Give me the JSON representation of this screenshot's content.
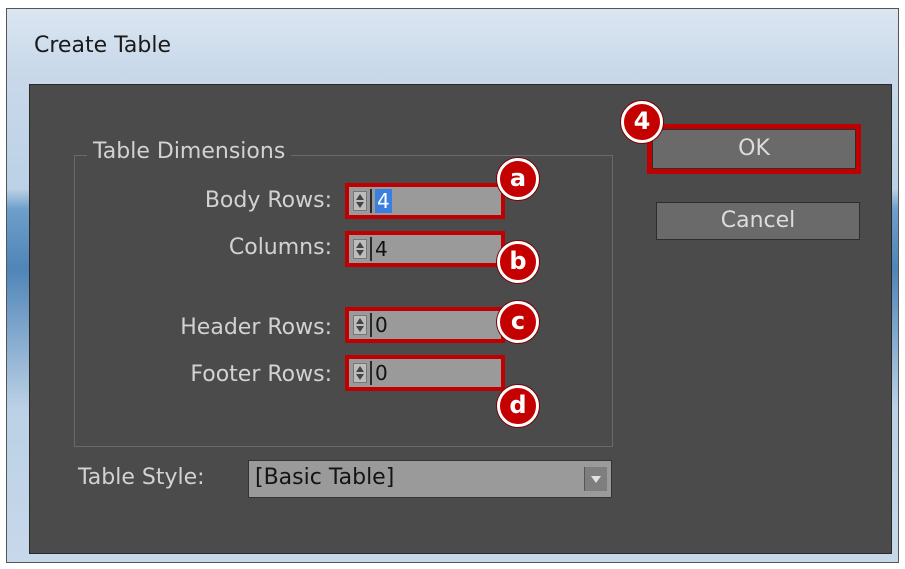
{
  "window": {
    "title": "Create Table"
  },
  "dimensions": {
    "legend": "Table Dimensions",
    "body_rows": {
      "label": "Body Rows:",
      "value": "4",
      "badge": "a"
    },
    "columns": {
      "label": "Columns:",
      "value": "4",
      "badge": "b"
    },
    "header_rows": {
      "label": "Header Rows:",
      "value": "0",
      "badge": "c"
    },
    "footer_rows": {
      "label": "Footer Rows:",
      "value": "0",
      "badge": "d"
    }
  },
  "buttons": {
    "ok": "OK",
    "cancel": "Cancel",
    "ok_badge": "4"
  },
  "table_style": {
    "label": "Table Style:",
    "value": "[Basic Table]"
  },
  "colors": {
    "highlight": "#c00000",
    "dialog_bg": "#4b4b4b",
    "selection": "#3a7ee0"
  }
}
